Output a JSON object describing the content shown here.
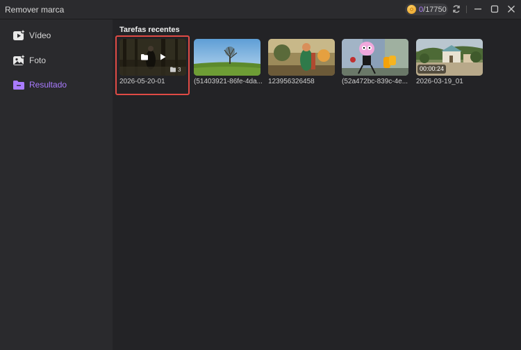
{
  "app": {
    "title": "Remover marca"
  },
  "credits": {
    "used": "0",
    "separator": "/",
    "total": "17750"
  },
  "sidebar": {
    "items": [
      {
        "label": "Vídeo",
        "icon": "video-icon"
      },
      {
        "label": "Foto",
        "icon": "photo-icon"
      },
      {
        "label": "Resultado",
        "icon": "folder-icon",
        "active": true
      }
    ]
  },
  "main": {
    "section_title": "Tarefas recentes",
    "cards": [
      {
        "label": "2026-05-20-01",
        "selected": true,
        "overlay_count": "3"
      },
      {
        "label": "(51403921-86fe-4da..."
      },
      {
        "label": "123956326458"
      },
      {
        "label": "(52a472bc-839c-4e..."
      },
      {
        "label": "2026-03-19_01",
        "duration": "00:00:24"
      }
    ]
  },
  "colors": {
    "accent": "#a97bff",
    "selection": "#e04b45",
    "background": "#232326",
    "sidebar": "#2a2a2d"
  }
}
